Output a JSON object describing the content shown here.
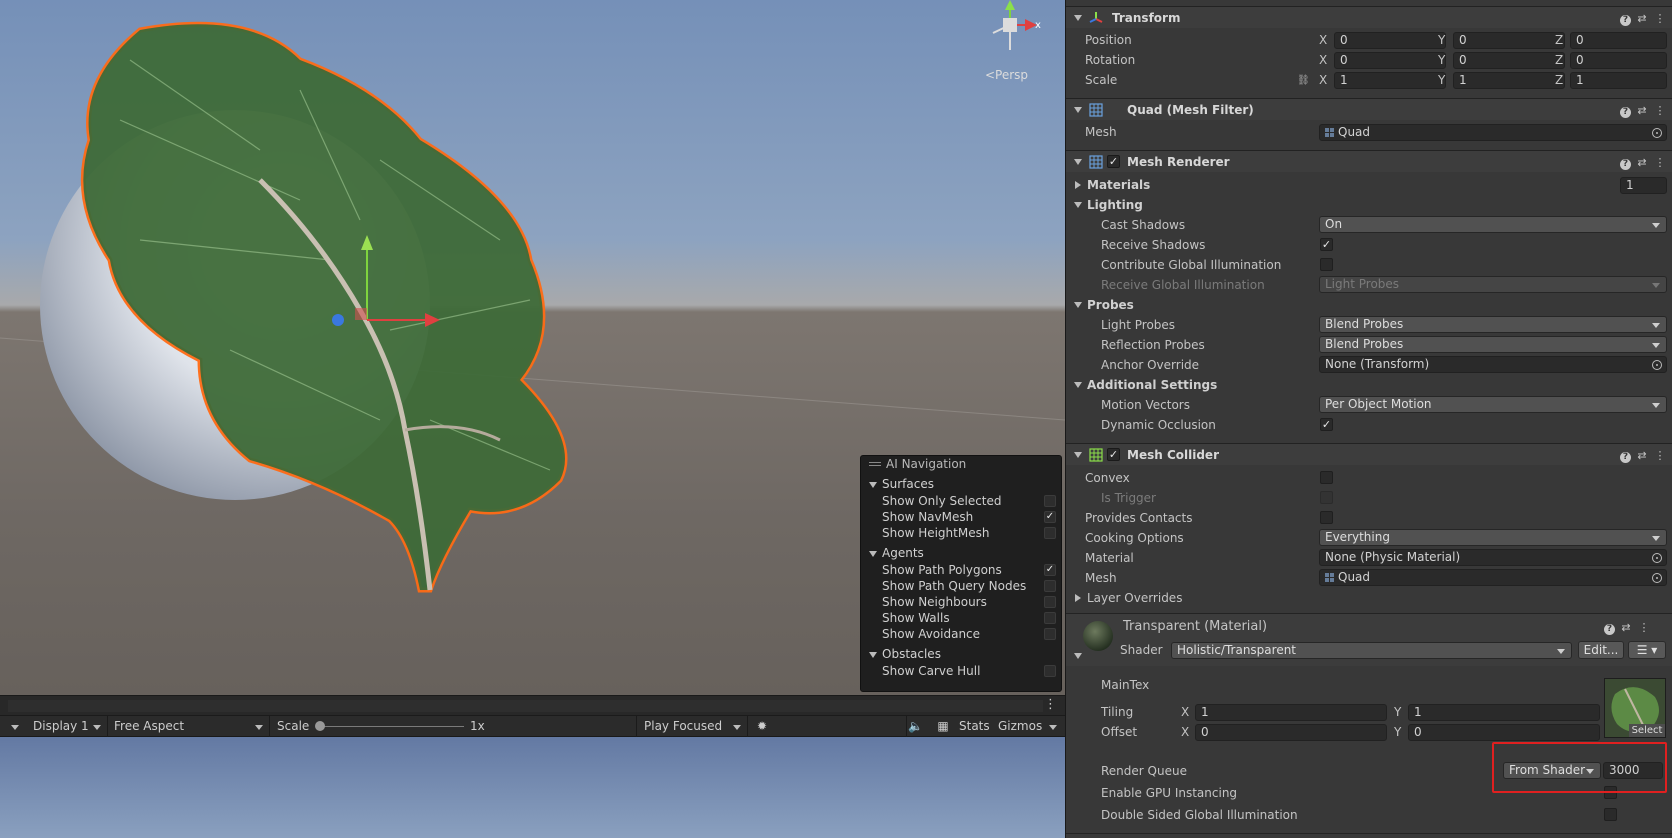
{
  "scene": {
    "projection_label": "<Persp"
  },
  "ai_navigation": {
    "title": "AI Navigation",
    "sections": [
      {
        "name": "Surfaces",
        "items": [
          {
            "label": "Show Only Selected",
            "checked": false
          },
          {
            "label": "Show NavMesh",
            "checked": true
          },
          {
            "label": "Show HeightMesh",
            "checked": false
          }
        ]
      },
      {
        "name": "Agents",
        "items": [
          {
            "label": "Show Path Polygons",
            "checked": true
          },
          {
            "label": "Show Path Query Nodes",
            "checked": false
          },
          {
            "label": "Show Neighbours",
            "checked": false
          },
          {
            "label": "Show Walls",
            "checked": false
          },
          {
            "label": "Show Avoidance",
            "checked": false
          }
        ]
      },
      {
        "name": "Obstacles",
        "items": [
          {
            "label": "Show Carve Hull",
            "checked": false
          }
        ]
      }
    ]
  },
  "game_toolbar": {
    "display": "Display 1",
    "aspect": "Free Aspect",
    "scale_label": "Scale",
    "scale_value": "1x",
    "play_mode": "Play Focused",
    "stats": "Stats",
    "gizmos": "Gizmos"
  },
  "inspector": {
    "transform": {
      "title": "Transform",
      "position_label": "Position",
      "rotation_label": "Rotation",
      "scale_label": "Scale",
      "axes": [
        "X",
        "Y",
        "Z"
      ],
      "position": [
        "0",
        "0",
        "0"
      ],
      "rotation": [
        "0",
        "0",
        "0"
      ],
      "scale": [
        "1",
        "1",
        "1"
      ]
    },
    "mesh_filter": {
      "title": "Quad (Mesh Filter)",
      "mesh_label": "Mesh",
      "mesh_value": "Quad"
    },
    "mesh_renderer": {
      "title": "Mesh Renderer",
      "enabled": true,
      "materials_label": "Materials",
      "materials_count": "1",
      "lighting_label": "Lighting",
      "cast_shadows_label": "Cast Shadows",
      "cast_shadows_value": "On",
      "receive_shadows_label": "Receive Shadows",
      "receive_shadows": true,
      "contribute_gi_label": "Contribute Global Illumination",
      "contribute_gi": false,
      "receive_gi_label": "Receive Global Illumination",
      "receive_gi_value": "Light Probes",
      "probes_label": "Probes",
      "light_probes_label": "Light Probes",
      "light_probes_value": "Blend Probes",
      "reflection_probes_label": "Reflection Probes",
      "reflection_probes_value": "Blend Probes",
      "anchor_override_label": "Anchor Override",
      "anchor_override_value": "None (Transform)",
      "additional_settings_label": "Additional Settings",
      "motion_vectors_label": "Motion Vectors",
      "motion_vectors_value": "Per Object Motion",
      "dynamic_occlusion_label": "Dynamic Occlusion",
      "dynamic_occlusion": true
    },
    "mesh_collider": {
      "title": "Mesh Collider",
      "enabled": true,
      "convex_label": "Convex",
      "is_trigger_label": "Is Trigger",
      "provides_contacts_label": "Provides Contacts",
      "cooking_options_label": "Cooking Options",
      "cooking_options_value": "Everything",
      "material_label": "Material",
      "material_value": "None (Physic Material)",
      "mesh_label": "Mesh",
      "mesh_value": "Quad",
      "layer_overrides_label": "Layer Overrides"
    },
    "material": {
      "title": "Transparent (Material)",
      "shader_label": "Shader",
      "shader_value": "Holistic/Transparent",
      "edit_label": "Edit...",
      "maintex_label": "MainTex",
      "tiling_label": "Tiling",
      "offset_label": "Offset",
      "tiling": [
        "1",
        "1"
      ],
      "offset": [
        "0",
        "0"
      ],
      "select_label": "Select",
      "render_queue_label": "Render Queue",
      "render_queue_mode": "From Shader",
      "render_queue_value": "3000",
      "gpu_instancing_label": "Enable GPU Instancing",
      "double_sided_gi_label": "Double Sided Global Illumination"
    }
  },
  "colors": {
    "selection_outline": "#ff6a14",
    "highlight_box": "#e02020",
    "panel_bg": "#383838"
  }
}
